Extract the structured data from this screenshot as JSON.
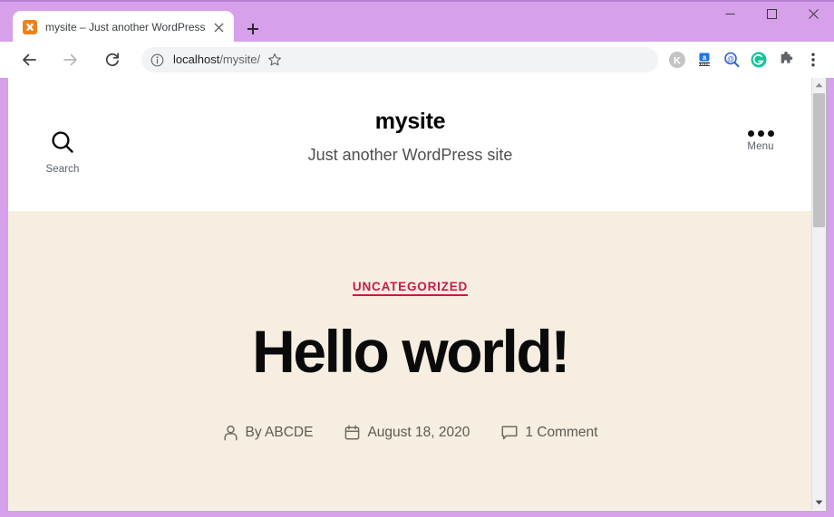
{
  "browser": {
    "tab": {
      "title": "mysite – Just another WordPress",
      "favicon_name": "xampp-favicon",
      "close_icon": "close-icon"
    },
    "new_tab_label": "+",
    "window_controls": {
      "minimize": "minimize-icon",
      "maximize": "maximize-icon",
      "close": "close-icon"
    },
    "toolbar": {
      "back": "back-arrow-icon",
      "forward": "forward-arrow-icon",
      "reload": "reload-icon",
      "site_info": "info-icon",
      "url_host": "localhost",
      "url_path": "/mysite/",
      "url_full": "localhost/mysite/",
      "bookmark": "star-icon",
      "extensions": [
        "kaspersky-icon",
        "grammarly-icon",
        "zoom-search-icon",
        "grammarly-g-icon",
        "puzzle-extensions-icon"
      ],
      "menu": "three-dot-menu-icon"
    },
    "colors": {
      "titlebar": "#d6a0ea",
      "omnibox": "#f1f3f4"
    }
  },
  "site": {
    "search": {
      "icon": "search-icon",
      "label": "Search"
    },
    "menu": {
      "icon": "three-dot-icon",
      "label": "Menu"
    },
    "title": "mysite",
    "tagline": "Just another WordPress site"
  },
  "post": {
    "category": "UNCATEGORIZED",
    "title": "Hello world!",
    "meta": {
      "author_icon": "person-icon",
      "author": "By ABCDE",
      "date_icon": "calendar-icon",
      "date": "August 18, 2020",
      "comments_icon": "comment-icon",
      "comments": "1 Comment"
    }
  },
  "theme_colors": {
    "page_background": "#f5eee1",
    "category_link": "#c9184a",
    "heading": "#0a0a0a",
    "meta_text": "#5d5a52"
  },
  "scrollbar": {
    "up_arrow": "scroll-up-arrow-icon",
    "down_arrow": "scroll-down-arrow-icon"
  }
}
